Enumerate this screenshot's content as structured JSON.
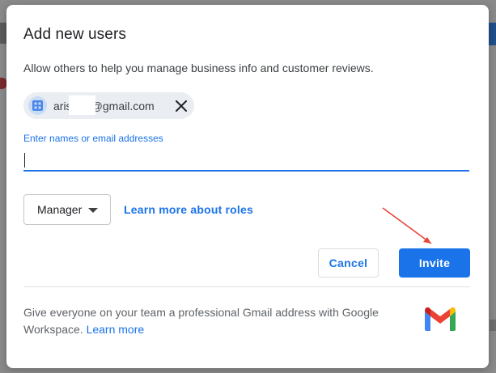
{
  "dialog": {
    "title": "Add new users",
    "subtitle": "Allow others to help you manage business info and customer reviews.",
    "chip": {
      "email": "aris      ara@gmail.com",
      "avatar_icon": "person-grid-icon",
      "close_icon": "close-icon"
    },
    "input": {
      "label": "Enter names or email addresses",
      "value": "",
      "placeholder": ""
    },
    "role_select": {
      "selected": "Manager",
      "icon": "caret-down-icon"
    },
    "learn_roles_link": "Learn more about roles",
    "buttons": {
      "cancel": "Cancel",
      "invite": "Invite"
    },
    "footer": {
      "text": "Give everyone on your team a professional Gmail address with Google Workspace.",
      "link": "Learn more",
      "logo_icon": "gmail-logo-icon"
    }
  },
  "colors": {
    "accent": "#1a73e8",
    "annotation_arrow": "#e8453c",
    "chip_background": "#eaedf1"
  }
}
